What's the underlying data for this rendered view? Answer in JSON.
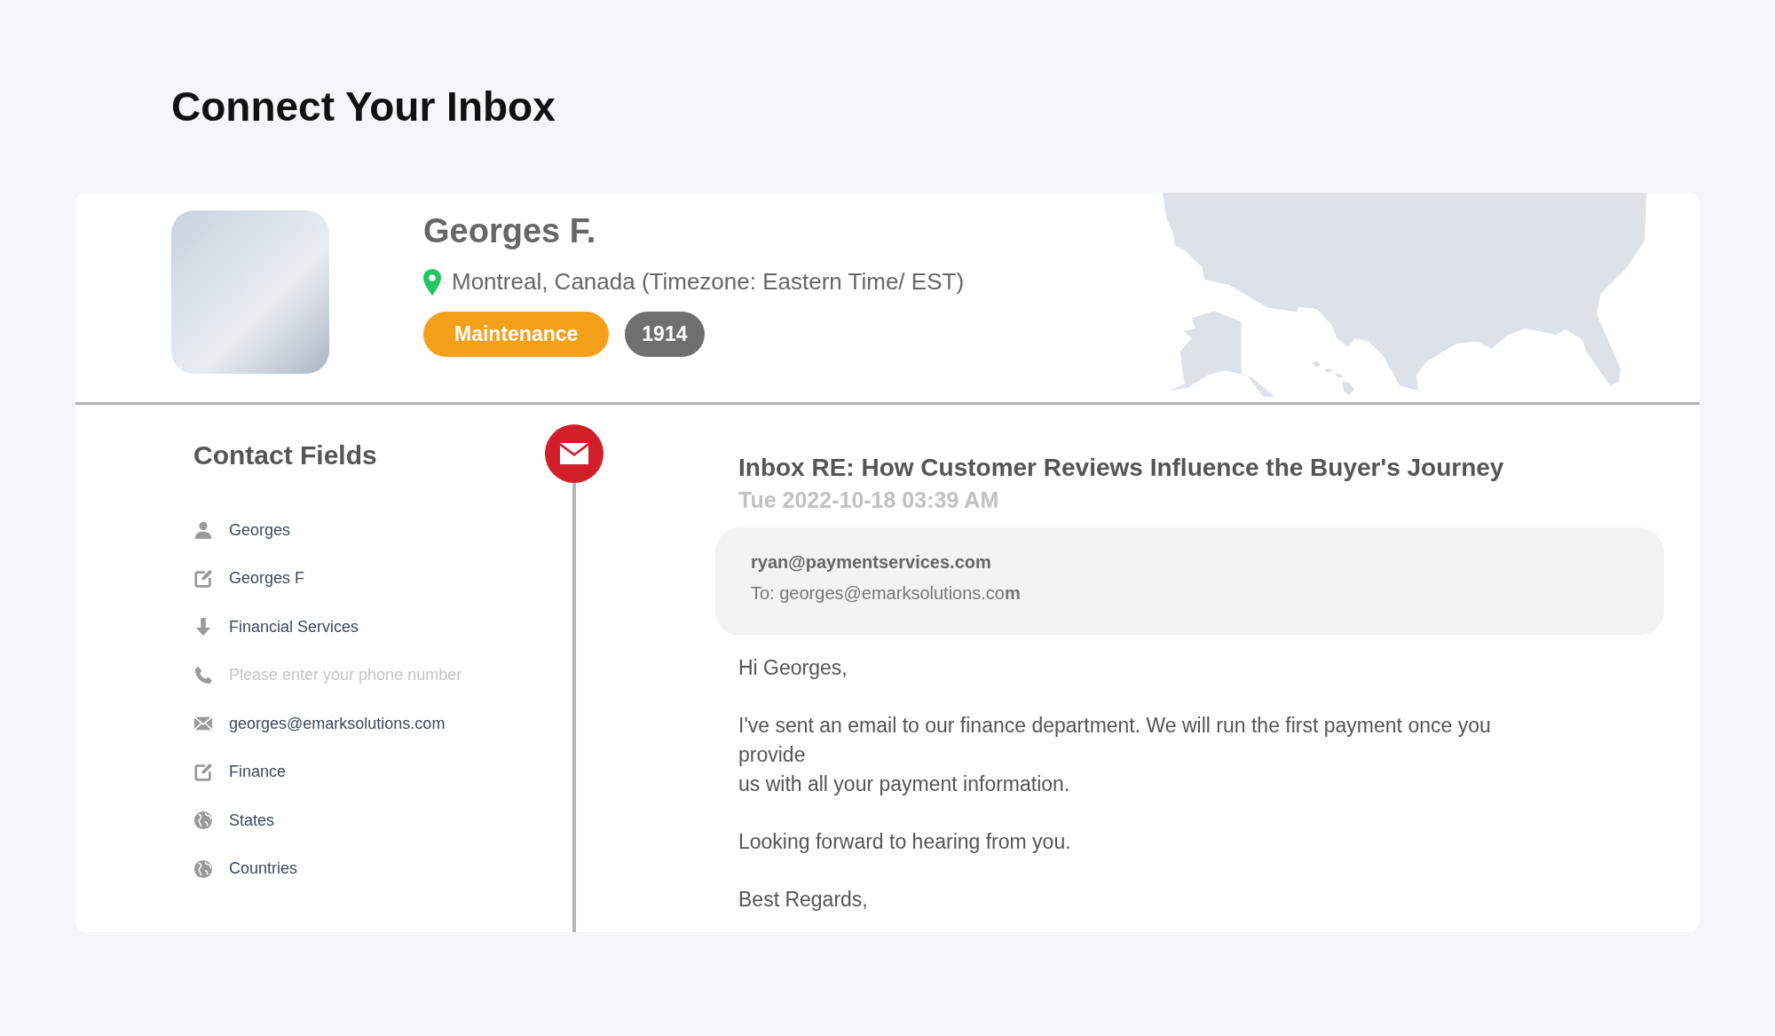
{
  "page_title": "Connect Your Inbox",
  "contact": {
    "name": "Georges F.",
    "location": "Montreal, Canada (Timezone: Eastern Time/ EST)",
    "tags": [
      {
        "label": "Maintenance",
        "color": "#f5a01a"
      },
      {
        "label": "1914",
        "color": "#6f6f6f"
      }
    ]
  },
  "contact_fields": {
    "title": "Contact Fields",
    "items": [
      {
        "kind": "person",
        "value": "Georges"
      },
      {
        "kind": "edit",
        "value": "Georges F"
      },
      {
        "kind": "arrow",
        "value": "Financial Services"
      },
      {
        "kind": "phone",
        "placeholder": "Please enter your phone number"
      },
      {
        "kind": "mail",
        "value": "georges@emarksolutions.com"
      },
      {
        "kind": "edit",
        "value": "Finance"
      },
      {
        "kind": "globe",
        "value": "States"
      },
      {
        "kind": "globe",
        "value": "Countries"
      }
    ]
  },
  "email": {
    "subject": "Inbox RE: How Customer Reviews Influence the Buyer's Journey",
    "date": "Tue 2022-10-18 03:39 AM",
    "from": "ryan@paymentservices.com",
    "to": "To: georges@emarksolutions.co**m**",
    "body": [
      "Hi Georges,",
      "I've sent an email to our finance department. We will run the first payment once you\nprovide\nus with all your payment information.",
      "Looking forward to hearing from you.",
      "Best Regards,"
    ]
  }
}
